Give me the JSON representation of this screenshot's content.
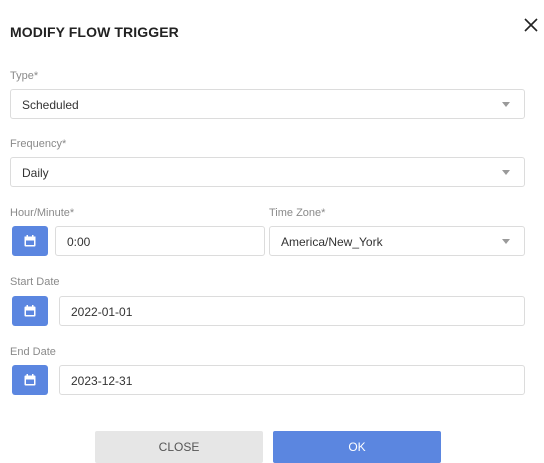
{
  "dialog": {
    "title": "MODIFY FLOW TRIGGER"
  },
  "type": {
    "label": "Type*",
    "value": "Scheduled"
  },
  "frequency": {
    "label": "Frequency*",
    "value": "Daily"
  },
  "hour_minute": {
    "label": "Hour/Minute*",
    "value": "0:00"
  },
  "time_zone": {
    "label": "Time Zone*",
    "value": "America/New_York"
  },
  "start_date": {
    "label": "Start Date",
    "value": "2022-01-01"
  },
  "end_date": {
    "label": "End Date",
    "value": "2023-12-31"
  },
  "buttons": {
    "close": "CLOSE",
    "ok": "OK"
  },
  "icons": {
    "close": "close-icon",
    "calendar": "calendar-icon",
    "dropdown": "chevron-down-icon"
  },
  "colors": {
    "accent": "#5b86e0",
    "secondary_button": "#e6e6e6"
  }
}
